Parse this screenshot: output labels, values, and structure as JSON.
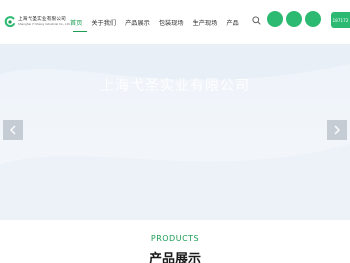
{
  "brand": {
    "name_cn": "上海弋圣实业有限公司",
    "name_en": "Shanghai Yi Sheng Industrial Co., Ltd.",
    "accent": "#1b9e54",
    "button_color": "#2cba72"
  },
  "nav": {
    "items": [
      {
        "label": "首页",
        "active": true
      },
      {
        "label": "关于我们",
        "active": false
      },
      {
        "label": "产品展示",
        "active": false
      },
      {
        "label": "包装现场",
        "active": false
      },
      {
        "label": "生产现场",
        "active": false
      },
      {
        "label": "产品",
        "active": false
      }
    ]
  },
  "header": {
    "search_icon": "search-icon",
    "phone": "187172"
  },
  "banner": {
    "title": "上海弋圣实业有限公司",
    "prev_icon": "chevron-left-icon",
    "next_icon": "chevron-right-icon"
  },
  "products": {
    "heading_en": "PRODUCTS",
    "heading_cn": "产品展示"
  }
}
